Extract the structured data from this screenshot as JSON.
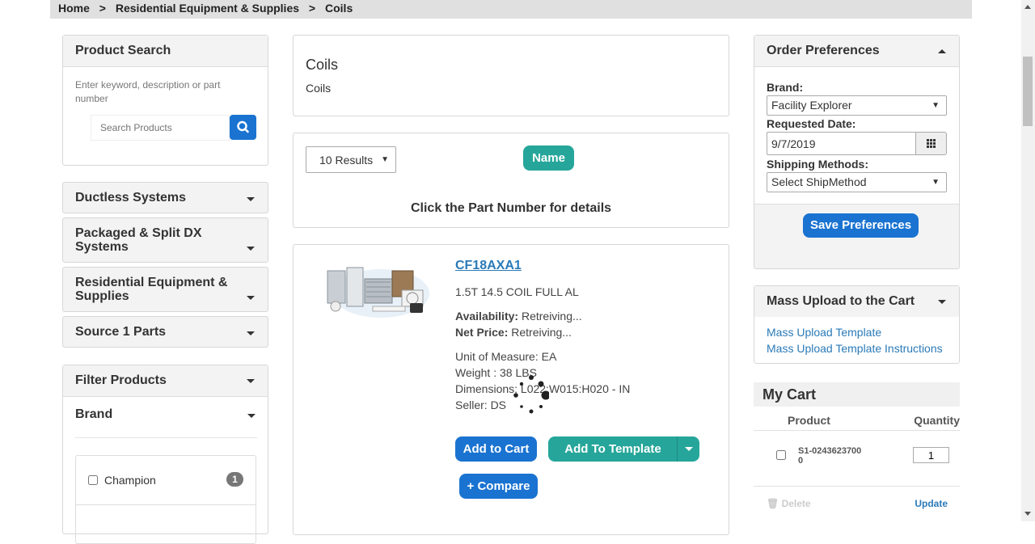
{
  "breadcrumb": {
    "home": "Home",
    "sep": ">",
    "category": "Residential Equipment & Supplies",
    "current": "Coils"
  },
  "product_search": {
    "title": "Product Search",
    "hint": "Enter keyword, description or part number",
    "placeholder": "Search Products"
  },
  "categories": [
    "Ductless Systems",
    "Packaged & Split DX Systems",
    "Residential Equipment & Supplies",
    "Source 1 Parts"
  ],
  "filter": {
    "title": "Filter Products",
    "brand_title": "Brand",
    "items": [
      {
        "label": "Champion",
        "count": "1"
      }
    ]
  },
  "category_header": {
    "title": "Coils",
    "description": "Coils"
  },
  "results": {
    "per_page": "10 Results",
    "sort_label": "Name",
    "instruction": "Click the Part Number for details"
  },
  "product": {
    "part_number": "CF18AXA1",
    "description": "1.5T 14.5 COIL FULL AL",
    "availability_label": "Availability:",
    "availability_value": "Retreiving...",
    "price_label": "Net Price:",
    "price_value": "Retreiving...",
    "uom": "Unit of Measure: EA",
    "weight": "Weight : 38 LBS",
    "dimensions": "Dimensions: L022:W015:H020 - IN",
    "seller": "Seller: DS",
    "add_to_cart": "Add to Cart",
    "add_to_template": "Add To Template",
    "compare": "+ Compare"
  },
  "order_prefs": {
    "title": "Order Preferences",
    "brand_label": "Brand:",
    "brand_value": "Facility Explorer",
    "date_label": "Requested Date:",
    "date_value": "9/7/2019",
    "ship_label": "Shipping Methods:",
    "ship_value": "Select ShipMethod",
    "save": "Save Preferences"
  },
  "mass_upload": {
    "title": "Mass Upload to the Cart",
    "link1": "Mass Upload Template",
    "link2": "Mass Upload Template Instructions"
  },
  "cart": {
    "title": "My Cart",
    "col_product": "Product",
    "col_qty": "Quantity",
    "items": [
      {
        "product": "S1-02436237000",
        "qty": "1"
      }
    ],
    "delete": "Delete",
    "update": "Update"
  }
}
